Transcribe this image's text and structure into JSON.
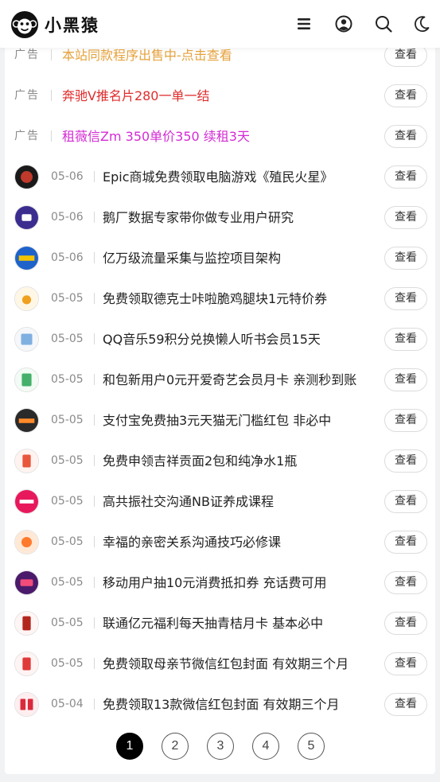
{
  "header": {
    "site_name": "小黑猿",
    "icons": [
      "menu-icon",
      "user-icon",
      "search-icon",
      "moon-icon"
    ]
  },
  "ads": [
    {
      "tag": "广告",
      "text": "本站同款程序出售中-点击查看",
      "color": "#e6a23c",
      "button": "查看"
    },
    {
      "tag": "广告",
      "text": "奔驰Ⅴ推名片280一单一结",
      "color": "#e02d2d",
      "button": "查看"
    },
    {
      "tag": "广告",
      "text": "租薇信Zm 350单价350 续租3天",
      "color": "#d42cd4",
      "button": "查看"
    }
  ],
  "posts": [
    {
      "date": "05-06",
      "title": "Epic商城免费领取电脑游戏《殖民火星》",
      "button": "查看"
    },
    {
      "date": "05-06",
      "title": "鹅厂数据专家带你做专业用户研究",
      "button": "查看"
    },
    {
      "date": "05-06",
      "title": "亿万级流量采集与监控项目架构",
      "button": "查看"
    },
    {
      "date": "05-05",
      "title": "免费领取德克士咔啦脆鸡腿块1元特价券",
      "button": "查看"
    },
    {
      "date": "05-05",
      "title": "QQ音乐59积分兑换懒人听书会员15天",
      "button": "查看"
    },
    {
      "date": "05-05",
      "title": "和包新用户0元开爱奇艺会员月卡 亲测秒到账",
      "button": "查看"
    },
    {
      "date": "05-05",
      "title": "支付宝免费抽3元天猫无门槛红包 非必中",
      "button": "查看"
    },
    {
      "date": "05-05",
      "title": "免费申领吉祥贡面2包和纯净水1瓶",
      "button": "查看"
    },
    {
      "date": "05-05",
      "title": "高共振社交沟通NB证养成课程",
      "button": "查看"
    },
    {
      "date": "05-05",
      "title": "幸福的亲密关系沟通技巧必修课",
      "button": "查看"
    },
    {
      "date": "05-05",
      "title": "移动用户抽10元消费抵扣券 充话费可用",
      "button": "查看"
    },
    {
      "date": "05-05",
      "title": "联通亿元福利每天抽青桔月卡 基本必中",
      "button": "查看"
    },
    {
      "date": "05-05",
      "title": "免费领取母亲节微信红包封面 有效期三个月",
      "button": "查看"
    },
    {
      "date": "05-04",
      "title": "免费领取13款微信红包封面 有效期三个月",
      "button": "查看"
    }
  ],
  "thumb_colors": [
    [
      "#1a1a1a",
      "#c0392b"
    ],
    [
      "#3b2d8f",
      "#ffffff"
    ],
    [
      "#1e63c9",
      "#f2c400"
    ],
    [
      "#fff7e6",
      "#f0a020"
    ],
    [
      "#f5f7fa",
      "#7fb0e0"
    ],
    [
      "#f2fbf4",
      "#44b06a"
    ],
    [
      "#2a2a2a",
      "#ff8a2b"
    ],
    [
      "#fff3f0",
      "#e8553d"
    ],
    [
      "#e8185c",
      "#ffffff"
    ],
    [
      "#ffe9d6",
      "#ff7a2e"
    ],
    [
      "#4a1a6b",
      "#f24c7a"
    ],
    [
      "#fff5f5",
      "#b3261e"
    ],
    [
      "#fff4f4",
      "#e03a3a"
    ],
    [
      "#ffeef0",
      "#d92b3b"
    ]
  ],
  "pagination": {
    "pages": [
      "1",
      "2",
      "3",
      "4",
      "5"
    ],
    "active": "1"
  }
}
